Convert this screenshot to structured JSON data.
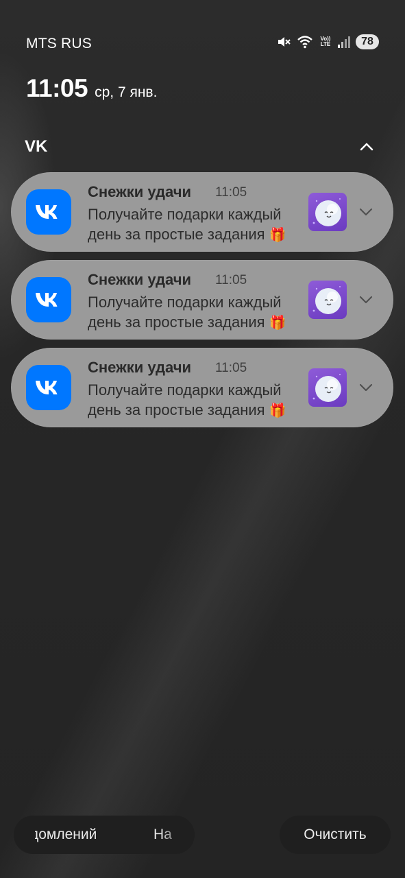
{
  "status_bar": {
    "carrier": "MTS RUS",
    "volte_top": "Vo))",
    "volte_bottom": "LTE",
    "battery": "78"
  },
  "lock": {
    "time": "11:05",
    "date": "ср, 7 янв."
  },
  "group": {
    "title": "VK"
  },
  "notifications": [
    {
      "title": "Снежки удачи",
      "time": "11:05",
      "body": "Получайте подарки каждый день за простые задания",
      "emoji": "🎁"
    },
    {
      "title": "Снежки удачи",
      "time": "11:05",
      "body": "Получайте подарки каждый день за простые задания",
      "emoji": "🎁"
    },
    {
      "title": "Снежки удачи",
      "time": "11:05",
      "body": "Получайте подарки каждый день за простые задания",
      "emoji": "🎁"
    }
  ],
  "bottom": {
    "left_text_1": "домлений",
    "left_text_2": "На",
    "clear_label": "Очистить"
  },
  "colors": {
    "vk_blue": "#0077ff",
    "notification_bg": "#9a9a9a",
    "thumbnail_purple": "#7b48cc"
  },
  "icons": [
    "mute-icon",
    "wifi-icon",
    "signal-icon",
    "vk-logo-icon",
    "snowball-icon",
    "chevron-up-icon",
    "chevron-down-icon"
  ]
}
